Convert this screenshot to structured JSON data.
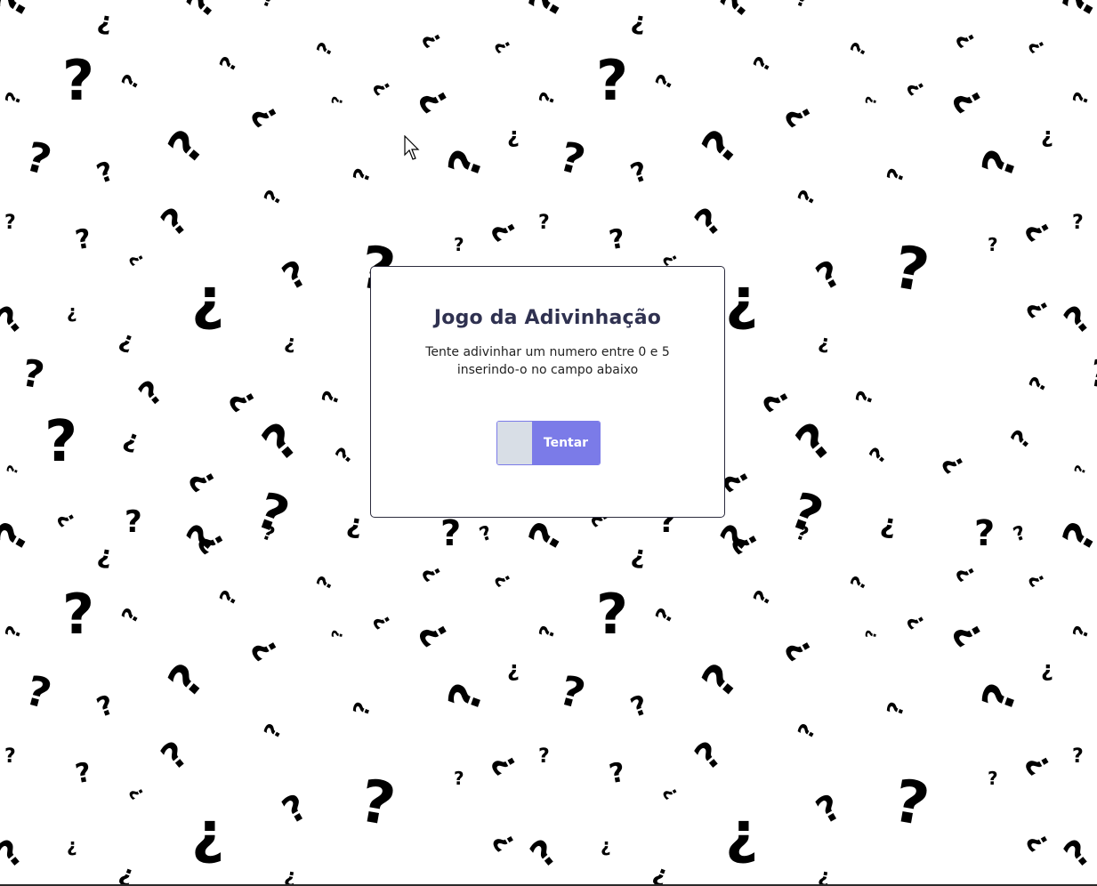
{
  "background": {
    "pattern": "question-marks",
    "glyphs": [
      "?",
      "¿"
    ],
    "color": "#000000"
  },
  "card": {
    "title": "Jogo da Adivinhação",
    "description": "Tente adivinhar um numero entre 0 e 5 inserindo-o no campo abaixo",
    "input_value": "",
    "button_label": "Tentar"
  },
  "colors": {
    "title": "#2f3150",
    "button": "#7b7be8",
    "input": "#d8dee6"
  }
}
